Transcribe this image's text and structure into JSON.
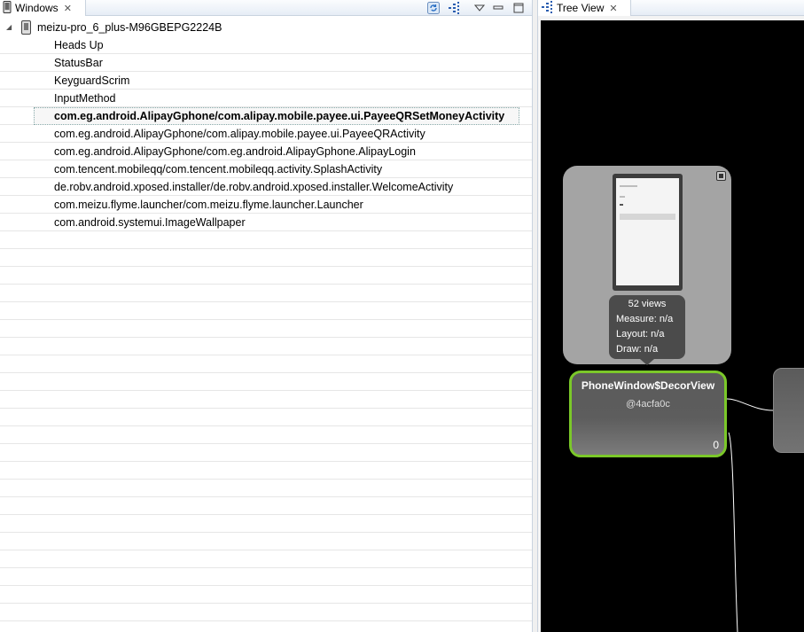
{
  "left_panel": {
    "tab_label": "Windows",
    "device": "meizu-pro_6_plus-M96GBEPG2224B",
    "windows": [
      "Heads Up",
      "StatusBar",
      "KeyguardScrim",
      "InputMethod",
      "com.eg.android.AlipayGphone/com.alipay.mobile.payee.ui.PayeeQRSetMoneyActivity",
      "com.eg.android.AlipayGphone/com.alipay.mobile.payee.ui.PayeeQRActivity",
      "com.eg.android.AlipayGphone/com.eg.android.AlipayGphone.AlipayLogin",
      "com.tencent.mobileqq/com.tencent.mobileqq.activity.SplashActivity",
      "de.robv.android.xposed.installer/de.robv.android.xposed.installer.WelcomeActivity",
      "com.meizu.flyme.launcher/com.meizu.flyme.launcher.Launcher",
      "com.android.systemui.ImageWallpaper"
    ],
    "selected_window": "com.eg.android.AlipayGphone/com.alipay.mobile.payee.ui.PayeeQRSetMoneyActivity",
    "toolbar_icons": [
      "refresh-icon",
      "load-view-hierarchy-icon",
      "view-menu-icon",
      "minimize-icon",
      "maximize-icon"
    ]
  },
  "right_panel": {
    "tab_label": "Tree View",
    "preview": {
      "views": "52 views",
      "measure": "Measure: n/a",
      "layout": "Layout: n/a",
      "draw": "Draw: n/a"
    },
    "root_node": {
      "title": "PhoneWindow$DecorView",
      "id": "@4acfa0c",
      "index": "0"
    }
  },
  "colors": {
    "selected_node_border": "#7bc829",
    "canvas_background": "#000000",
    "node_fill": "#5b5b5b"
  }
}
